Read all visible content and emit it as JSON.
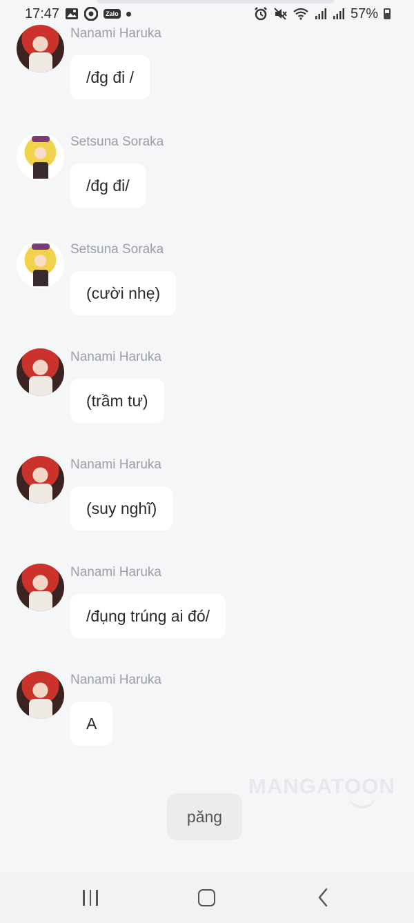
{
  "status_bar": {
    "time": "17:47",
    "battery_text": "57%",
    "battery_level": 0.57,
    "left_icons": [
      "gallery-icon",
      "chrome-like-icon",
      "zalo-icon",
      "notification-dot-icon"
    ],
    "zalo_label": "Zalo",
    "right_icons": [
      "alarm-icon",
      "mute-icon",
      "wifi-icon",
      "signal-icon",
      "signal-icon",
      "battery-icon"
    ]
  },
  "chat": {
    "messages": [
      {
        "sender": "Nanami Haruka",
        "text": "/đg đi /"
      },
      {
        "sender": "Setsuna Soraka",
        "text": "/đg đi/"
      },
      {
        "sender": "Setsuna Soraka",
        "text": "(cười nhẹ)"
      },
      {
        "sender": "Nanami Haruka",
        "text": "(trầm tư)"
      },
      {
        "sender": "Nanami Haruka",
        "text": "(suy nghĩ)"
      },
      {
        "sender": "Nanami Haruka",
        "text": "/đụng trúng ai đó/"
      },
      {
        "sender": "Nanami Haruka",
        "text": "A"
      }
    ],
    "narration": "păng"
  },
  "watermark": "MANGATOON",
  "nav_bar": {
    "icons": [
      "recent-apps-icon",
      "home-icon",
      "back-icon"
    ]
  }
}
